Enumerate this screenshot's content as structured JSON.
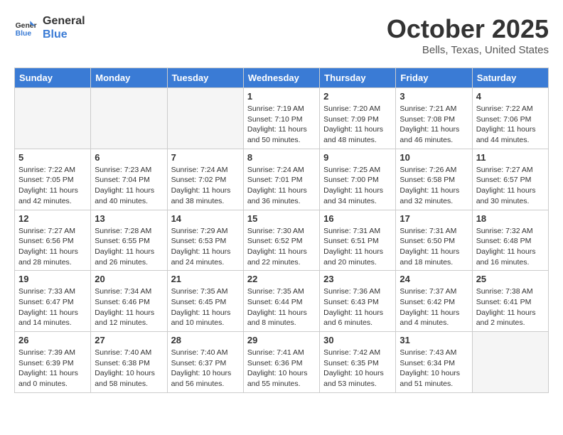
{
  "header": {
    "logo_line1": "General",
    "logo_line2": "Blue",
    "month": "October 2025",
    "location": "Bells, Texas, United States"
  },
  "weekdays": [
    "Sunday",
    "Monday",
    "Tuesday",
    "Wednesday",
    "Thursday",
    "Friday",
    "Saturday"
  ],
  "weeks": [
    [
      {
        "day": "",
        "info": ""
      },
      {
        "day": "",
        "info": ""
      },
      {
        "day": "",
        "info": ""
      },
      {
        "day": "1",
        "info": "Sunrise: 7:19 AM\nSunset: 7:10 PM\nDaylight: 11 hours\nand 50 minutes."
      },
      {
        "day": "2",
        "info": "Sunrise: 7:20 AM\nSunset: 7:09 PM\nDaylight: 11 hours\nand 48 minutes."
      },
      {
        "day": "3",
        "info": "Sunrise: 7:21 AM\nSunset: 7:08 PM\nDaylight: 11 hours\nand 46 minutes."
      },
      {
        "day": "4",
        "info": "Sunrise: 7:22 AM\nSunset: 7:06 PM\nDaylight: 11 hours\nand 44 minutes."
      }
    ],
    [
      {
        "day": "5",
        "info": "Sunrise: 7:22 AM\nSunset: 7:05 PM\nDaylight: 11 hours\nand 42 minutes."
      },
      {
        "day": "6",
        "info": "Sunrise: 7:23 AM\nSunset: 7:04 PM\nDaylight: 11 hours\nand 40 minutes."
      },
      {
        "day": "7",
        "info": "Sunrise: 7:24 AM\nSunset: 7:02 PM\nDaylight: 11 hours\nand 38 minutes."
      },
      {
        "day": "8",
        "info": "Sunrise: 7:24 AM\nSunset: 7:01 PM\nDaylight: 11 hours\nand 36 minutes."
      },
      {
        "day": "9",
        "info": "Sunrise: 7:25 AM\nSunset: 7:00 PM\nDaylight: 11 hours\nand 34 minutes."
      },
      {
        "day": "10",
        "info": "Sunrise: 7:26 AM\nSunset: 6:58 PM\nDaylight: 11 hours\nand 32 minutes."
      },
      {
        "day": "11",
        "info": "Sunrise: 7:27 AM\nSunset: 6:57 PM\nDaylight: 11 hours\nand 30 minutes."
      }
    ],
    [
      {
        "day": "12",
        "info": "Sunrise: 7:27 AM\nSunset: 6:56 PM\nDaylight: 11 hours\nand 28 minutes."
      },
      {
        "day": "13",
        "info": "Sunrise: 7:28 AM\nSunset: 6:55 PM\nDaylight: 11 hours\nand 26 minutes."
      },
      {
        "day": "14",
        "info": "Sunrise: 7:29 AM\nSunset: 6:53 PM\nDaylight: 11 hours\nand 24 minutes."
      },
      {
        "day": "15",
        "info": "Sunrise: 7:30 AM\nSunset: 6:52 PM\nDaylight: 11 hours\nand 22 minutes."
      },
      {
        "day": "16",
        "info": "Sunrise: 7:31 AM\nSunset: 6:51 PM\nDaylight: 11 hours\nand 20 minutes."
      },
      {
        "day": "17",
        "info": "Sunrise: 7:31 AM\nSunset: 6:50 PM\nDaylight: 11 hours\nand 18 minutes."
      },
      {
        "day": "18",
        "info": "Sunrise: 7:32 AM\nSunset: 6:48 PM\nDaylight: 11 hours\nand 16 minutes."
      }
    ],
    [
      {
        "day": "19",
        "info": "Sunrise: 7:33 AM\nSunset: 6:47 PM\nDaylight: 11 hours\nand 14 minutes."
      },
      {
        "day": "20",
        "info": "Sunrise: 7:34 AM\nSunset: 6:46 PM\nDaylight: 11 hours\nand 12 minutes."
      },
      {
        "day": "21",
        "info": "Sunrise: 7:35 AM\nSunset: 6:45 PM\nDaylight: 11 hours\nand 10 minutes."
      },
      {
        "day": "22",
        "info": "Sunrise: 7:35 AM\nSunset: 6:44 PM\nDaylight: 11 hours\nand 8 minutes."
      },
      {
        "day": "23",
        "info": "Sunrise: 7:36 AM\nSunset: 6:43 PM\nDaylight: 11 hours\nand 6 minutes."
      },
      {
        "day": "24",
        "info": "Sunrise: 7:37 AM\nSunset: 6:42 PM\nDaylight: 11 hours\nand 4 minutes."
      },
      {
        "day": "25",
        "info": "Sunrise: 7:38 AM\nSunset: 6:41 PM\nDaylight: 11 hours\nand 2 minutes."
      }
    ],
    [
      {
        "day": "26",
        "info": "Sunrise: 7:39 AM\nSunset: 6:39 PM\nDaylight: 11 hours\nand 0 minutes."
      },
      {
        "day": "27",
        "info": "Sunrise: 7:40 AM\nSunset: 6:38 PM\nDaylight: 10 hours\nand 58 minutes."
      },
      {
        "day": "28",
        "info": "Sunrise: 7:40 AM\nSunset: 6:37 PM\nDaylight: 10 hours\nand 56 minutes."
      },
      {
        "day": "29",
        "info": "Sunrise: 7:41 AM\nSunset: 6:36 PM\nDaylight: 10 hours\nand 55 minutes."
      },
      {
        "day": "30",
        "info": "Sunrise: 7:42 AM\nSunset: 6:35 PM\nDaylight: 10 hours\nand 53 minutes."
      },
      {
        "day": "31",
        "info": "Sunrise: 7:43 AM\nSunset: 6:34 PM\nDaylight: 10 hours\nand 51 minutes."
      },
      {
        "day": "",
        "info": ""
      }
    ]
  ]
}
